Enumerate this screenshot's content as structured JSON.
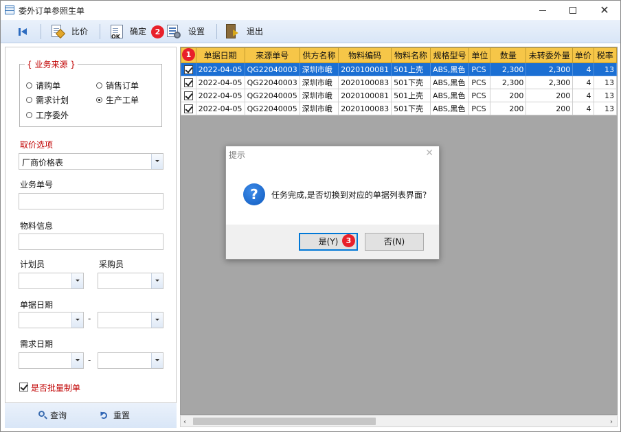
{
  "window": {
    "title": "委外订单参照生单",
    "close_glyph": "✕"
  },
  "toolbar": {
    "compare_label": "比价",
    "confirm_label": "确定",
    "confirm_icon_text": "OK",
    "settings_label": "设置",
    "exit_label": "退出"
  },
  "badges": {
    "one": "1",
    "two": "2",
    "three": "3"
  },
  "left_panel": {
    "source_group_title": "{ 业务来源 }",
    "radios": [
      {
        "label": "请购单",
        "selected": false
      },
      {
        "label": "销售订单",
        "selected": false
      },
      {
        "label": "需求计划",
        "selected": false
      },
      {
        "label": "生产工单",
        "selected": true
      },
      {
        "label": "工序委外",
        "selected": false
      }
    ],
    "price_option_label": "取价选项",
    "price_option_value": "厂商价格表",
    "business_no_label": "业务单号",
    "material_info_label": "物料信息",
    "planner_label": "计划员",
    "buyer_label": "采购员",
    "doc_date_label": "单据日期",
    "demand_date_label": "需求日期",
    "range_separator": "-",
    "batch_label": "是否批量制单",
    "query_label": "查询",
    "reset_label": "重置"
  },
  "grid": {
    "columns": [
      "单据日期",
      "来源单号",
      "供方名称",
      "物料编码",
      "物料名称",
      "规格型号",
      "单位",
      "数量",
      "未转委外量",
      "单价",
      "税率"
    ],
    "rows": [
      [
        "2022-04-05",
        "QG22040003",
        "深圳市峨",
        "2020100081",
        "501上壳",
        "ABS,黑色",
        "PCS",
        "2,300",
        "2,300",
        "4",
        "13"
      ],
      [
        "2022-04-05",
        "QG22040003",
        "深圳市峨",
        "2020100083",
        "501下壳",
        "ABS,黑色",
        "PCS",
        "2,300",
        "2,300",
        "4",
        "13"
      ],
      [
        "2022-04-05",
        "QG22040005",
        "深圳市峨",
        "2020100081",
        "501上壳",
        "ABS,黑色",
        "PCS",
        "200",
        "200",
        "4",
        "13"
      ],
      [
        "2022-04-05",
        "QG22040005",
        "深圳市峨",
        "2020100083",
        "501下壳",
        "ABS,黑色",
        "PCS",
        "200",
        "200",
        "4",
        "13"
      ]
    ],
    "selected_row": 0,
    "scroll_left": "‹",
    "scroll_right": "›"
  },
  "dialog": {
    "title": "提示",
    "close_glyph": "✕",
    "icon_glyph": "?",
    "message": "任务完成,是否切换到对应的单据列表界面?",
    "yes_label": "是(Y)",
    "no_label": "否(N)"
  },
  "colors": {
    "header_bg": "#f6c648",
    "selected_row_bg": "#1b6fd3",
    "badge_red": "#e8202a",
    "grid_empty_bg": "#a6a6a6"
  }
}
